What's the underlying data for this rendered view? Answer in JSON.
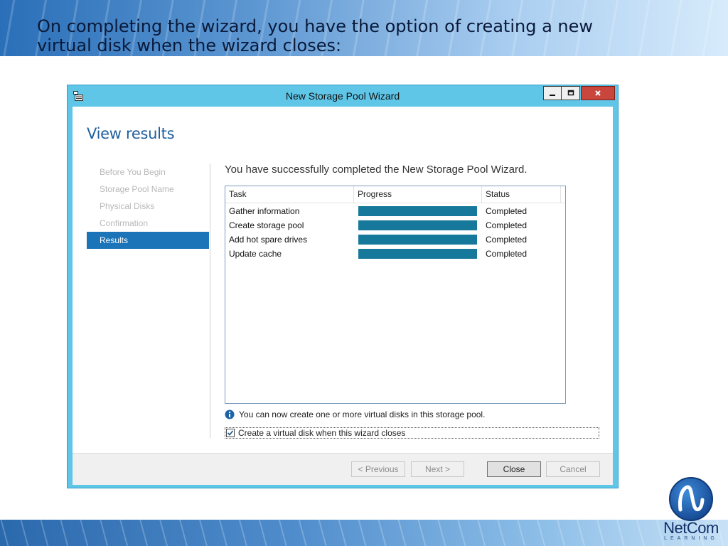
{
  "slide": {
    "title_lines": [
      "On completing the wizard, you have the option of creating a new",
      "virtual disk when the wizard closes:"
    ]
  },
  "window": {
    "title": "New Storage Pool Wizard",
    "heading": "View results",
    "success_message": "You have successfully completed the New Storage Pool Wizard.",
    "steps": [
      {
        "label": "Before You Begin",
        "active": false
      },
      {
        "label": "Storage Pool Name",
        "active": false
      },
      {
        "label": "Physical Disks",
        "active": false
      },
      {
        "label": "Confirmation",
        "active": false
      },
      {
        "label": "Results",
        "active": true
      }
    ],
    "table": {
      "columns": [
        "Task",
        "Progress",
        "Status"
      ],
      "rows": [
        {
          "task": "Gather information",
          "progress": 1.0,
          "status": "Completed"
        },
        {
          "task": "Create storage pool",
          "progress": 1.0,
          "status": "Completed"
        },
        {
          "task": "Add hot spare drives",
          "progress": 1.0,
          "status": "Completed"
        },
        {
          "task": "Update cache",
          "progress": 1.0,
          "status": "Completed"
        }
      ]
    },
    "info_text": "You can now create one or more virtual disks in this storage pool.",
    "checkbox": {
      "label": "Create a virtual disk when this wizard closes",
      "checked": true
    },
    "buttons": {
      "previous": "< Previous",
      "next": "Next >",
      "close": "Close",
      "cancel": "Cancel"
    }
  },
  "logo": {
    "name": "NetCom",
    "sub": "LEARNING"
  },
  "colors": {
    "window_frame": "#5fc6e8",
    "heading": "#1f5f9e",
    "active_step": "#1b74b8",
    "progress_fill": "#16789a",
    "close_control": "#c9463d"
  },
  "icons": {
    "app": "storage-pool-icon",
    "minimize": "minimize-icon",
    "maximize": "maximize-icon",
    "close": "close-icon",
    "info": "info-icon",
    "check": "checkmark-icon"
  }
}
